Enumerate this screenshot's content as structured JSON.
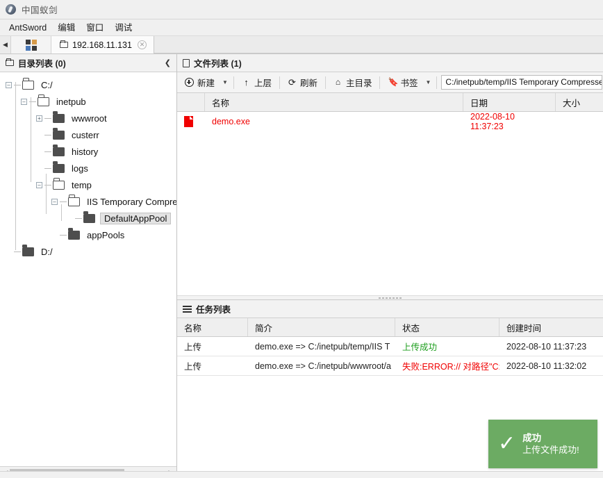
{
  "window": {
    "title": "中国蚁剑",
    "logo_icon": "antsword-logo-icon"
  },
  "menubar": {
    "items": [
      {
        "label": "AntSword"
      },
      {
        "label": "编辑"
      },
      {
        "label": "窗口"
      },
      {
        "label": "调试"
      }
    ]
  },
  "tabbar": {
    "scroll_left_icon": "chevron-left-icon",
    "grid_icon": "grid-view-icon",
    "tabs": [
      {
        "label": "192.168.11.131",
        "folder_icon": "folder-icon",
        "close_icon": "close-icon",
        "close_glyph": "✕"
      }
    ]
  },
  "tree_panel": {
    "header": {
      "icon": "folder-icon",
      "title": "目录列表 (0)",
      "collapse_icon": "chevron-left-icon",
      "collapse_glyph": "❮"
    },
    "nodes": [
      {
        "label": "C:/",
        "depth": 0,
        "toggle": "minus",
        "folder": "open",
        "selected": false
      },
      {
        "label": "inetpub",
        "depth": 1,
        "toggle": "minus",
        "folder": "open",
        "selected": false
      },
      {
        "label": "wwwroot",
        "depth": 2,
        "toggle": "plus",
        "folder": "closed",
        "selected": false
      },
      {
        "label": "custerr",
        "depth": 2,
        "toggle": "none",
        "folder": "closed",
        "selected": false
      },
      {
        "label": "history",
        "depth": 2,
        "toggle": "none",
        "folder": "closed",
        "selected": false
      },
      {
        "label": "logs",
        "depth": 2,
        "toggle": "none",
        "folder": "closed",
        "selected": false
      },
      {
        "label": "temp",
        "depth": 2,
        "toggle": "minus",
        "folder": "open",
        "selected": false
      },
      {
        "label": "IIS Temporary Compressed",
        "depth": 3,
        "toggle": "minus",
        "folder": "open",
        "selected": false
      },
      {
        "label": "DefaultAppPool",
        "depth": 4,
        "toggle": "none",
        "folder": "closed",
        "selected": true
      },
      {
        "label": "appPools",
        "depth": 3,
        "toggle": "none",
        "folder": "closed",
        "selected": false
      },
      {
        "label": "D:/",
        "depth": 0,
        "toggle": "none",
        "folder": "closed",
        "selected": false
      }
    ],
    "hscroll": {
      "left_icon": "scroll-left-icon",
      "right_icon": "scroll-right-icon",
      "left_glyph": "◀",
      "right_glyph": "▶"
    }
  },
  "file_panel": {
    "header": {
      "icon": "file-icon",
      "title": "文件列表 (1)"
    },
    "toolbar": {
      "new_label": "新建",
      "new_icon": "plus-circle-icon",
      "up_label": "上层",
      "up_icon": "arrow-up-icon",
      "up_glyph": "↑",
      "refresh_label": "刷新",
      "refresh_icon": "refresh-icon",
      "refresh_glyph": "⟳",
      "home_label": "主目录",
      "home_icon": "home-icon",
      "home_glyph": "⌂",
      "bookmark_label": "书签",
      "bookmark_icon": "bookmark-icon",
      "bookmark_glyph": "🔖",
      "caret_glyph": "▼",
      "path_value": "C:/inetpub/temp/IIS Temporary Compressed"
    },
    "columns": [
      "",
      "名称",
      "日期",
      "大小"
    ],
    "rows": [
      {
        "icon": "exe-file-icon",
        "name": "demo.exe",
        "date": "2022-08-10 11:37:23",
        "size": ""
      }
    ]
  },
  "task_panel": {
    "header": {
      "icon": "task-list-icon",
      "title": "任务列表"
    },
    "columns": [
      "名称",
      "简介",
      "状态",
      "创建时间"
    ],
    "rows": [
      {
        "name": "上传",
        "summary": "demo.exe => C:/inetpub/temp/IIS T",
        "status": "上传成功",
        "status_color": "#1e9e1e",
        "created": "2022-08-10 11:37:23"
      },
      {
        "name": "上传",
        "summary": "demo.exe => C:/inetpub/wwwroot/a",
        "status": "失败:ERROR:// 对路径\"C:",
        "status_color": "#f00000",
        "created": "2022-08-10 11:32:02"
      }
    ]
  },
  "toast": {
    "icon": "check-icon",
    "check_glyph": "✓",
    "title": "成功",
    "message": "上传文件成功!",
    "background": "#6cab63"
  }
}
